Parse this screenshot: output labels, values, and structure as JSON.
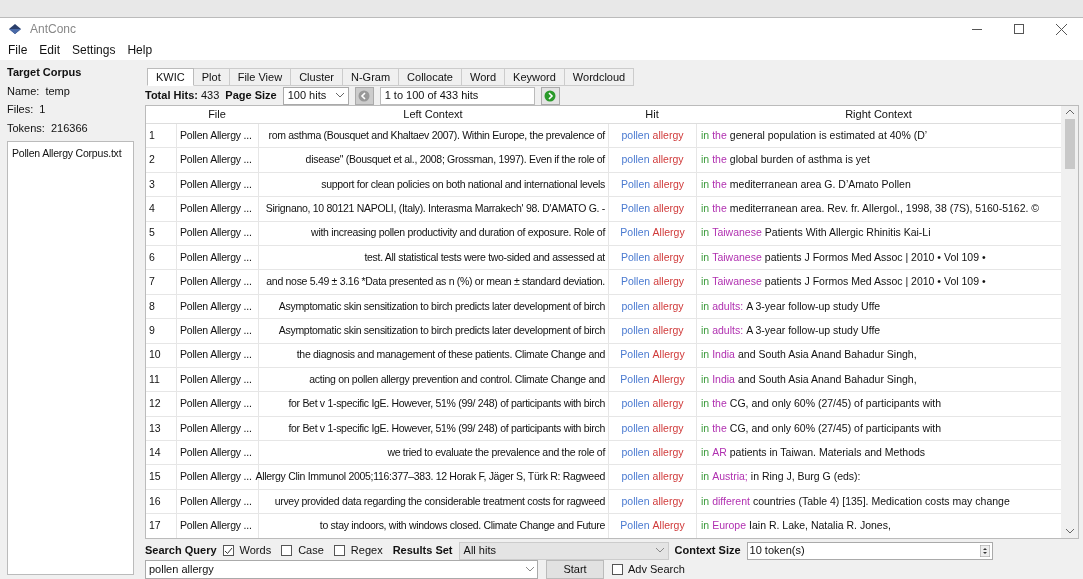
{
  "window": {
    "title": "AntConc"
  },
  "menu": [
    "File",
    "Edit",
    "Settings",
    "Help"
  ],
  "target_corpus": {
    "title": "Target Corpus",
    "name_label": "Name:",
    "name": "temp",
    "files_label": "Files:",
    "files": "1",
    "tokens_label": "Tokens:",
    "tokens": "216366",
    "files_list": [
      "Pollen Allergy Corpus.txt"
    ]
  },
  "tabs": [
    {
      "label": "KWIC",
      "selected": true
    },
    {
      "label": "Plot",
      "selected": false
    },
    {
      "label": "File View",
      "selected": false
    },
    {
      "label": "Cluster",
      "selected": false
    },
    {
      "label": "N-Gram",
      "selected": false
    },
    {
      "label": "Collocate",
      "selected": false
    },
    {
      "label": "Word",
      "selected": false
    },
    {
      "label": "Keyword",
      "selected": false
    },
    {
      "label": "Wordcloud",
      "selected": false
    }
  ],
  "toolbar": {
    "total_hits_label": "Total Hits:",
    "total_hits": "433",
    "page_size_label": "Page Size",
    "page_size": "100 hits",
    "range": "1 to 100 of 433 hits"
  },
  "table": {
    "columns": [
      "File",
      "Left Context",
      "Hit",
      "Right Context"
    ],
    "rows": [
      {
        "index": "1",
        "file": "Pollen Allergy ...",
        "left": "rom asthma (Bousquet and Khaltaev 2007). Within Europe, the prevalence of",
        "hit": [
          "pollen",
          "allergy"
        ],
        "right": [
          "in",
          "the",
          "general population is estimated at 40% (D’"
        ]
      },
      {
        "index": "2",
        "file": "Pollen Allergy ...",
        "left": "disease\" (Bousquet et al., 2008; Grossman, 1997). Even if the role of",
        "hit": [
          "pollen",
          "allergy"
        ],
        "right": [
          "in",
          "the",
          "global burden of asthma is yet"
        ]
      },
      {
        "index": "3",
        "file": "Pollen Allergy ...",
        "left": "support for clean policies on both national and international levels",
        "hit": [
          "Pollen",
          "allergy"
        ],
        "right": [
          "in",
          "the",
          "mediterranean area G. D’Amato Pollen"
        ]
      },
      {
        "index": "4",
        "file": "Pollen Allergy ...",
        "left": "Sirignano, 10 80121 NAPOLI, (Italy). Interasma Marrakech' 98. D'AMATO G. -",
        "hit": [
          "Pollen",
          "allergy"
        ],
        "right": [
          "in",
          "the",
          "mediterranean area. Rev. fr. Allergol., 1998, 38 (7S), 5160-5162. ©"
        ]
      },
      {
        "index": "5",
        "file": "Pollen Allergy ...",
        "left": "with increasing pollen productivity and duration of exposure. Role of",
        "hit": [
          "Pollen",
          "Allergy"
        ],
        "right": [
          "in",
          "Taiwanese",
          "Patients With Allergic Rhinitis Kai-Li"
        ]
      },
      {
        "index": "6",
        "file": "Pollen Allergy ...",
        "left": "test. All statistical tests were two-sided and assessed at",
        "hit": [
          "Pollen",
          "allergy"
        ],
        "right": [
          "in",
          "Taiwanese",
          "patients J Formos Med Assoc | 2010 • Vol 109 •"
        ]
      },
      {
        "index": "7",
        "file": "Pollen Allergy ...",
        "left": "and nose 5.49 ± 3.16 *Data presented as n (%) or mean ± standard deviation.",
        "hit": [
          "Pollen",
          "allergy"
        ],
        "right": [
          "in",
          "Taiwanese",
          "patients J Formos Med Assoc | 2010 • Vol 109 •"
        ]
      },
      {
        "index": "8",
        "file": "Pollen Allergy ...",
        "left": "Asymptomatic skin sensitization to birch predicts later development of birch",
        "hit": [
          "pollen",
          "allergy"
        ],
        "right": [
          "in",
          "adults:",
          "A 3-year follow-up study Uffe"
        ]
      },
      {
        "index": "9",
        "file": "Pollen Allergy ...",
        "left": "Asymptomatic skin sensitization to birch predicts later development of birch",
        "hit": [
          "pollen",
          "allergy"
        ],
        "right": [
          "in",
          "adults:",
          "A 3-year follow-up study Uffe"
        ]
      },
      {
        "index": "10",
        "file": "Pollen Allergy ...",
        "left": "the diagnosis and management of these patients. Climate Change and",
        "hit": [
          "Pollen",
          "Allergy"
        ],
        "right": [
          "in",
          "India",
          "and South Asia Anand Bahadur Singh,"
        ]
      },
      {
        "index": "11",
        "file": "Pollen Allergy ...",
        "left": "acting on pollen allergy prevention and control. Climate Change and",
        "hit": [
          "Pollen",
          "Allergy"
        ],
        "right": [
          "in",
          "India",
          "and South Asia Anand Bahadur Singh,"
        ]
      },
      {
        "index": "12",
        "file": "Pollen Allergy ...",
        "left": "for Bet v 1-specific IgE. However, 51% (99/ 248) of participants with birch",
        "hit": [
          "pollen",
          "allergy"
        ],
        "right": [
          "in",
          "the",
          "CG, and only 60% (27/45) of participants with"
        ]
      },
      {
        "index": "13",
        "file": "Pollen Allergy ...",
        "left": "for Bet v 1-specific IgE. However, 51% (99/ 248) of participants with birch",
        "hit": [
          "pollen",
          "allergy"
        ],
        "right": [
          "in",
          "the",
          "CG, and only 60% (27/45) of participants with"
        ]
      },
      {
        "index": "14",
        "file": "Pollen Allergy ...",
        "left": "we tried to evaluate the prevalence and the role of",
        "hit": [
          "pollen",
          "allergy"
        ],
        "right": [
          "in",
          "AR",
          "patients in Taiwan. Materials and Methods"
        ]
      },
      {
        "index": "15",
        "file": "Pollen Allergy ...",
        "left": "Allergy Clin Immunol 2005;116:377–383. 12 Horak F, Jäger S, Türk R: Ragweed",
        "hit": [
          "pollen",
          "allergy"
        ],
        "right": [
          "in",
          "Austria;",
          "in Ring J, Burg G (eds):"
        ]
      },
      {
        "index": "16",
        "file": "Pollen Allergy ...",
        "left": "urvey provided data regarding the considerable treatment costs for ragweed",
        "hit": [
          "pollen",
          "allergy"
        ],
        "right": [
          "in",
          "different",
          "countries (Table 4) [135]. Medication costs may change"
        ]
      },
      {
        "index": "17",
        "file": "Pollen Allergy ...",
        "left": "to stay indoors, with windows closed. Climate Change and Future",
        "hit": [
          "Pollen",
          "Allergy"
        ],
        "right": [
          "in",
          "Europe",
          "Iain R. Lake, Natalia R. Jones,"
        ]
      }
    ]
  },
  "search": {
    "label": "Search Query",
    "options": [
      {
        "label": "Words",
        "checked": true
      },
      {
        "label": "Case",
        "checked": false
      },
      {
        "label": "Regex",
        "checked": false
      }
    ],
    "results_set_label": "Results Set",
    "results_set": "All hits",
    "context_size_label": "Context Size",
    "context_size": "10 token(s)",
    "query": "pollen allergy",
    "start": "Start",
    "adv_search": {
      "label": "Adv Search",
      "checked": false
    }
  }
}
